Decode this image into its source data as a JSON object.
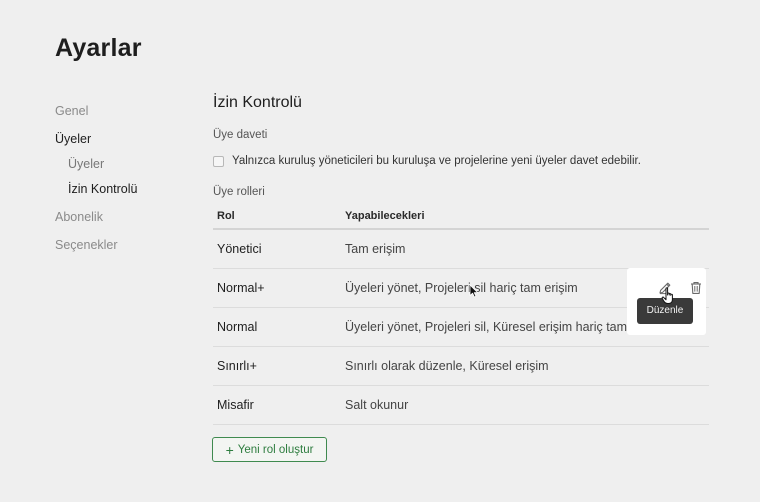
{
  "page": {
    "title": "Ayarlar"
  },
  "sidebar": {
    "items": [
      {
        "label": "Genel"
      },
      {
        "label": "Üyeler"
      },
      {
        "label": "Üyeler"
      },
      {
        "label": "İzin Kontrolü"
      },
      {
        "label": "Abonelik"
      },
      {
        "label": "Seçenekler"
      }
    ]
  },
  "main": {
    "title": "İzin Kontrolü",
    "invite": {
      "heading": "Üye daveti",
      "checkbox_label": "Yalnızca kuruluş yöneticileri bu kuruluşa ve projelerine yeni üyeler davet edebilir.",
      "checked": false
    },
    "roles": {
      "heading": "Üye rolleri",
      "columns": [
        "Rol",
        "Yapabilecekleri"
      ],
      "rows": [
        {
          "role": "Yönetici",
          "permissions": "Tam erişim"
        },
        {
          "role": "Normal+",
          "permissions": "Üyeleri yönet, Projeleri sil hariç tam erişim"
        },
        {
          "role": "Normal",
          "permissions": "Üyeleri yönet, Projeleri sil, Küresel erişim hariç tam erişim"
        },
        {
          "role": "Sınırlı+",
          "permissions": "Sınırlı olarak düzenle, Küresel erişim"
        },
        {
          "role": "Misafir",
          "permissions": "Salt okunur"
        }
      ]
    },
    "actions": {
      "tooltip": "Düzenle",
      "edit_icon": "pencil-icon",
      "delete_icon": "trash-icon"
    },
    "new_role_button": "Yeni rol oluştur"
  },
  "colors": {
    "background": "#efefef",
    "accent": "#2e7d3f",
    "tooltip_bg": "#3a3a3a"
  }
}
